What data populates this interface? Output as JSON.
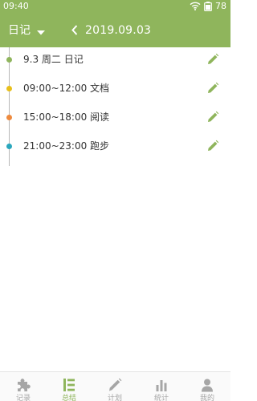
{
  "status_bar": {
    "time": "09:40",
    "battery": "78",
    "icons": [
      "wifi-icon",
      "battery-icon"
    ]
  },
  "header": {
    "view_label": "日记",
    "dropdown_icon": "caret-down-icon",
    "back_icon": "chevron-left-icon",
    "date": "2019.09.03",
    "background_color": "#8fb55c"
  },
  "timeline": {
    "entries": [
      {
        "text": "9.3  周二   日记",
        "dot_color": "#8fb55c",
        "action_icon": "pencil-icon"
      },
      {
        "text": "09:00~12:00   文档",
        "dot_color": "#e8bf1a",
        "action_icon": "pencil-icon"
      },
      {
        "text": "15:00~18:00   阅读",
        "dot_color": "#ee8a3e",
        "action_icon": "pencil-icon"
      },
      {
        "text": "21:00~23:00   跑步",
        "dot_color": "#2aa7bd",
        "action_icon": "pencil-icon"
      }
    ]
  },
  "tabbar": {
    "active_color": "#8fb55c",
    "inactive_color": "#a6a6a6",
    "tabs": [
      {
        "label": "记录",
        "icon": "puzzle-icon",
        "active": false
      },
      {
        "label": "总结",
        "icon": "list-icon",
        "active": true
      },
      {
        "label": "计划",
        "icon": "pencil-icon",
        "active": false
      },
      {
        "label": "统计",
        "icon": "bar-chart-icon",
        "active": false
      },
      {
        "label": "我的",
        "icon": "person-icon",
        "active": false
      }
    ]
  }
}
